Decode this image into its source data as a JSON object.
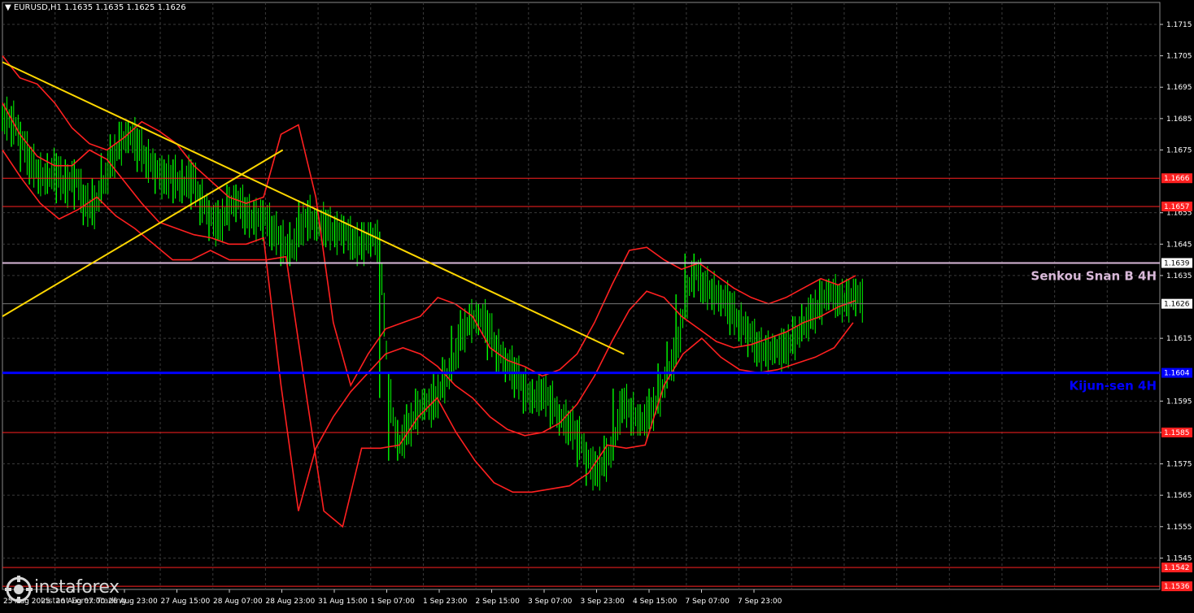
{
  "header": {
    "title": "EURUSD,H1 1.1635 1.1635 1.1625 1.1626"
  },
  "logo": {
    "brand": "instaforex",
    "tagline": "Instant Forex Trading"
  },
  "colors": {
    "background": "#000000",
    "grid": "#3a3a3a",
    "candle": "#00ff00",
    "bands": "#ff2020",
    "trendline": "#ffd700",
    "horizontal": "#ff2020",
    "senkou": "#d8b8d8",
    "kijun": "#0000ff",
    "axis": "#ffffff"
  },
  "chart_data": {
    "type": "line",
    "symbol": "EURUSD",
    "timeframe": "H1",
    "ylim": [
      1.1535,
      1.1722
    ],
    "y_ticks": [
      "1.1715",
      "1.1705",
      "1.1695",
      "1.1685",
      "1.1675",
      "1.1655",
      "1.1645",
      "1.1635",
      "1.1615",
      "1.1595",
      "1.1585",
      "1.1575",
      "1.1565",
      "1.1555",
      "1.1545"
    ],
    "x_ticks": [
      "25 Aug 2025",
      "26 Aug 07:00",
      "26 Aug 23:00",
      "27 Aug 15:00",
      "28 Aug 07:00",
      "28 Aug 23:00",
      "31 Aug 15:00",
      "1 Sep 07:00",
      "1 Sep 23:00",
      "2 Sep 15:00",
      "3 Sep 07:00",
      "3 Sep 23:00",
      "4 Sep 15:00",
      "7 Sep 07:00",
      "7 Sep 23:00"
    ],
    "current_price": 1.1626,
    "levels": [
      {
        "value": 1.1666,
        "tag": "1.1666",
        "kind": "resistance"
      },
      {
        "value": 1.1657,
        "tag": "1.1657",
        "kind": "resistance"
      },
      {
        "value": 1.1639,
        "tag": "1.1639",
        "kind": "senkou",
        "name": "Senkou Snan B 4H"
      },
      {
        "value": 1.1604,
        "tag": "1.1604",
        "kind": "kijun",
        "name": "Kijun-sen 4H"
      },
      {
        "value": 1.1585,
        "tag": "1.1585",
        "kind": "support"
      },
      {
        "value": 1.1542,
        "tag": "1.1542",
        "kind": "support"
      },
      {
        "value": 1.1536,
        "tag": "1.1536",
        "kind": "support"
      }
    ],
    "price_path": [
      1.1685,
      1.168,
      1.1672,
      1.1668,
      1.1665,
      1.167,
      1.1662,
      1.1668,
      1.166,
      1.1655,
      1.1662,
      1.167,
      1.1676,
      1.168,
      1.1678,
      1.1672,
      1.167,
      1.1665,
      1.1668,
      1.1662,
      1.1668,
      1.166,
      1.1655,
      1.165,
      1.1655,
      1.166,
      1.1656,
      1.1652,
      1.1655,
      1.165,
      1.1647,
      1.1642,
      1.1648,
      1.1655,
      1.165,
      1.1652,
      1.1648,
      1.165,
      1.1646,
      1.1644,
      1.1648,
      1.1645,
      1.16,
      1.158,
      1.1585,
      1.159,
      1.1595,
      1.1593,
      1.16,
      1.1605,
      1.1615,
      1.162,
      1.1622,
      1.162,
      1.1612,
      1.1608,
      1.1605,
      1.16,
      1.1595,
      1.1598,
      1.1596,
      1.159,
      1.1588,
      1.1585,
      1.1578,
      1.1572,
      1.1575,
      1.158,
      1.1595,
      1.1592,
      1.1588,
      1.159,
      1.1595,
      1.1603,
      1.161,
      1.1625,
      1.1638,
      1.1632,
      1.163,
      1.1628,
      1.1626,
      1.162,
      1.1618,
      1.1613,
      1.161,
      1.1612,
      1.1611,
      1.1614,
      1.1618,
      1.1622,
      1.1625,
      1.163,
      1.1628,
      1.1626,
      1.163,
      1.1626
    ],
    "bollinger_upper": [
      1.1705,
      1.1698,
      1.1696,
      1.169,
      1.1682,
      1.1677,
      1.1675,
      1.1679,
      1.1684,
      1.1681,
      1.1677,
      1.167,
      1.1665,
      1.166,
      1.1658,
      1.166,
      1.168,
      1.1683,
      1.166,
      1.162,
      1.16,
      1.161,
      1.1618,
      1.162,
      1.1622,
      1.1628,
      1.1626,
      1.1622,
      1.1612,
      1.1608,
      1.1606,
      1.1603,
      1.1605,
      1.161,
      1.162,
      1.1632,
      1.1643,
      1.1644,
      1.164,
      1.1637,
      1.1639,
      1.1635,
      1.1631,
      1.1628,
      1.1626,
      1.1628,
      1.1631,
      1.1634,
      1.1632,
      1.1635
    ],
    "bollinger_middle": [
      1.169,
      1.168,
      1.1673,
      1.167,
      1.167,
      1.1675,
      1.1672,
      1.1665,
      1.1658,
      1.1652,
      1.165,
      1.1648,
      1.1647,
      1.1645,
      1.1645,
      1.1647,
      1.16,
      1.156,
      1.158,
      1.159,
      1.1598,
      1.1604,
      1.161,
      1.1612,
      1.161,
      1.1606,
      1.16,
      1.1596,
      1.159,
      1.1586,
      1.1584,
      1.1585,
      1.1588,
      1.1594,
      1.1603,
      1.1614,
      1.1624,
      1.163,
      1.1628,
      1.1622,
      1.1618,
      1.1614,
      1.1612,
      1.1613,
      1.1615,
      1.1617,
      1.162,
      1.1622,
      1.1625,
      1.1627
    ],
    "bollinger_lower": [
      1.1675,
      1.1666,
      1.1658,
      1.1653,
      1.1656,
      1.166,
      1.1654,
      1.165,
      1.1645,
      1.164,
      1.164,
      1.1643,
      1.164,
      1.164,
      1.164,
      1.1641,
      1.16,
      1.156,
      1.1555,
      1.158,
      1.158,
      1.1581,
      1.159,
      1.1596,
      1.1585,
      1.1576,
      1.1569,
      1.1566,
      1.1566,
      1.1567,
      1.1568,
      1.1572,
      1.1581,
      1.158,
      1.1581,
      1.16,
      1.161,
      1.1615,
      1.1609,
      1.1605,
      1.1604,
      1.1605,
      1.1607,
      1.1609,
      1.1612,
      1.162
    ],
    "trendlines": [
      {
        "x": [
          0,
          0.51
        ],
        "y": [
          1.1703,
          1.161
        ]
      },
      {
        "x": [
          0,
          0.23
        ],
        "y": [
          1.1622,
          1.1675
        ]
      }
    ]
  }
}
